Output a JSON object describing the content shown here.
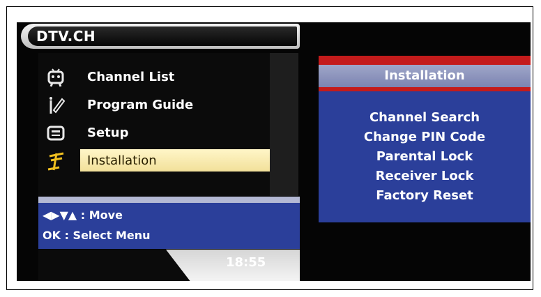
{
  "header": {
    "title": "DTV.CH"
  },
  "menu": {
    "items": [
      {
        "label": "Channel List",
        "icon": "tv-face-icon"
      },
      {
        "label": "Program Guide",
        "icon": "pen-guide-icon"
      },
      {
        "label": "Setup",
        "icon": "setup-box-icon"
      },
      {
        "label": "Installation",
        "icon": "antenna-icon",
        "selected": true
      }
    ]
  },
  "help": {
    "move": "◀▶▼▲ : Move",
    "select": "OK : Select Menu"
  },
  "clock": "18:55",
  "submenu": {
    "title": "Installation",
    "items": [
      "Channel Search",
      "Change PIN Code",
      "Parental Lock",
      "Receiver Lock",
      "Factory Reset"
    ]
  },
  "colors": {
    "panel_blue": "#2b3f9a",
    "accent_red": "#c41b1b",
    "highlight": "#f6e8a8"
  }
}
